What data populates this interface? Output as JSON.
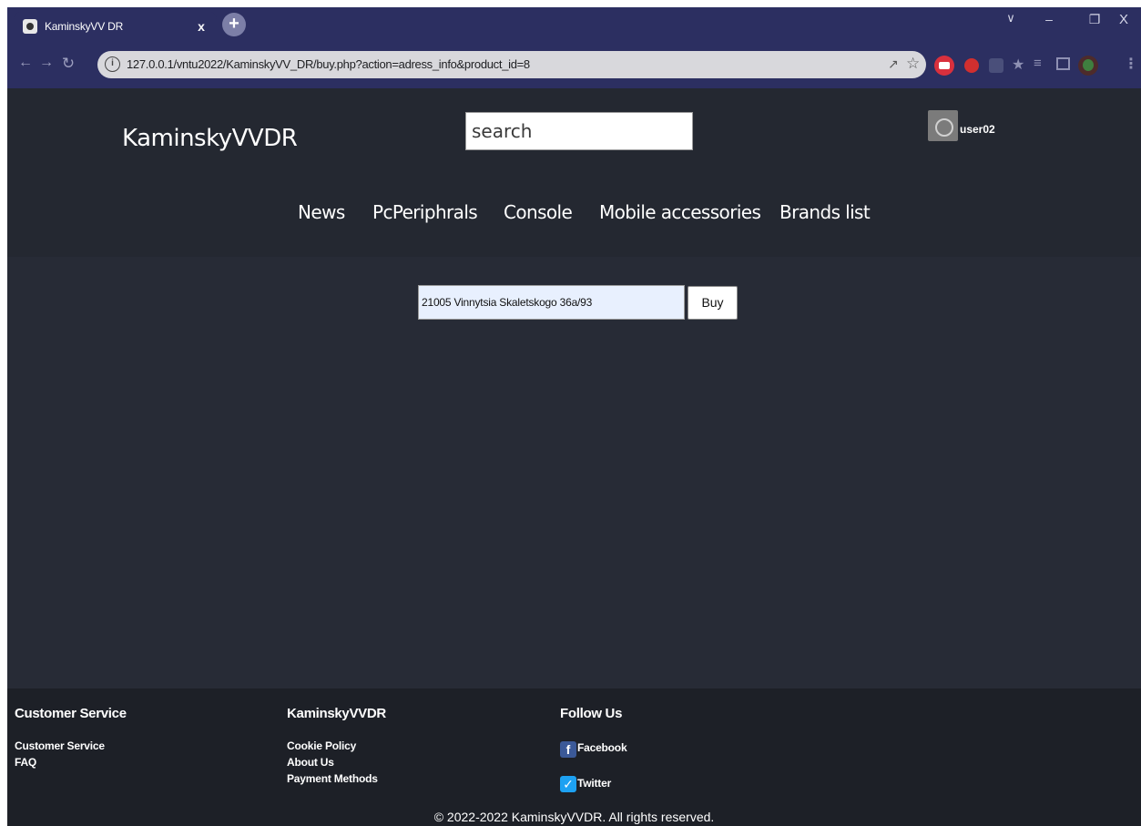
{
  "browser": {
    "tab_title": "KaminskyVV DR",
    "tab_close": "x",
    "new_tab": "+",
    "url": "127.0.0.1/vntu2022/KaminskyVV_DR/buy.php?action=adress_info&product_id=8"
  },
  "header": {
    "logo": "KaminskyVVDR",
    "search_text": "search",
    "username": "user02"
  },
  "nav": {
    "items": [
      "News",
      "PcPeriphrals",
      "Console",
      "Mobile accessories",
      "Brands list"
    ]
  },
  "form": {
    "address_value": "21005 Vinnytsia Skaletskogo 36a/93",
    "buy_label": "Buy"
  },
  "footer": {
    "col1": {
      "heading": "Customer Service",
      "links": [
        "Customer Service",
        "FAQ"
      ]
    },
    "col2": {
      "heading": "KaminskyVVDR",
      "links": [
        "Cookie Policy",
        "About Us",
        "Payment Methods"
      ]
    },
    "col3": {
      "heading": "Follow Us",
      "links": [
        "Facebook",
        "Twitter"
      ]
    },
    "copyright": "© 2022-2022 KaminskyVVDR. All rights reserved."
  },
  "colors": {
    "browser_bar": "#2c2f61",
    "header_bg": "#242831",
    "page_bg": "#272b36",
    "footer_bg": "#1d2027",
    "input_autofill": "#e8f0fe"
  }
}
